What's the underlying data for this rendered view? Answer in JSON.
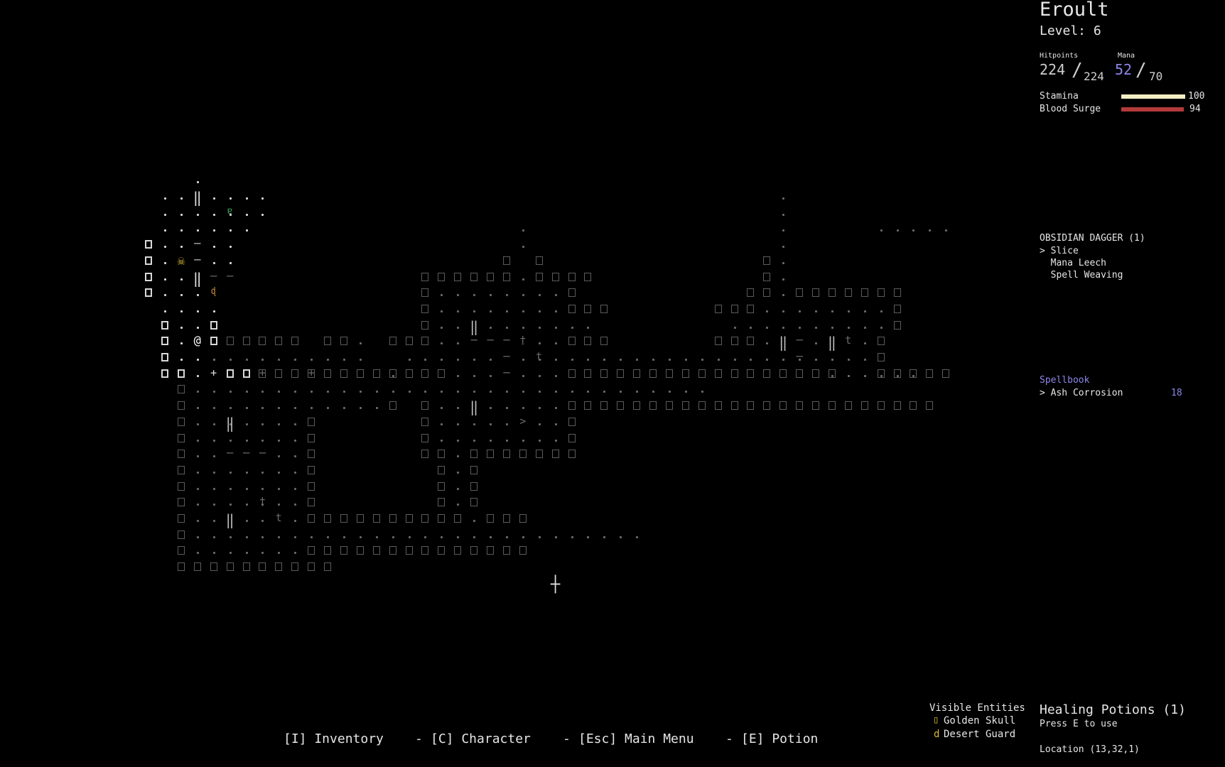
{
  "player": {
    "name": "Eroult",
    "level_label": "Level: 6"
  },
  "stats": {
    "hp_label": "Hitpoints",
    "hp_current": "224",
    "hp_max": "224",
    "mana_label": "Mana",
    "mana_current": "52",
    "mana_max": "70",
    "stamina_label": "Stamina",
    "stamina_value": "100",
    "stamina_fill": 1.0,
    "blood_label": "Blood Surge",
    "blood_value": "94",
    "blood_fill": 0.98
  },
  "weapon": {
    "title": "OBSIDIAN DAGGER (1)",
    "abilities": [
      "> Slice",
      "  Mana Leech",
      "  Spell Weaving"
    ]
  },
  "spellbook": {
    "title": "Spellbook",
    "spells": [
      {
        "name": "> Ash Corrosion",
        "cost": "18"
      }
    ]
  },
  "entities": {
    "title": "Visible Entities",
    "items": [
      {
        "glyph": "▯",
        "name": "Golden Skull"
      },
      {
        "glyph": "d",
        "name": "Desert Guard"
      }
    ]
  },
  "potions": {
    "title": "Healing Potions (1)",
    "hint": "Press E to use"
  },
  "location": "Location (13,32,1)",
  "footer": {
    "inventory": "[I] Inventory",
    "sep1": "-",
    "character": "[C] Character",
    "sep2": "-",
    "main_menu": "[Esc] Main Menu",
    "sep3": "-",
    "potion": "[E] Potion"
  },
  "colors": {
    "mana": "#8d87e8",
    "stamina": "#f3edc4",
    "blood": "#b23a3a",
    "spellbook": "#8d87e8",
    "skull": "#d8b832",
    "guard": "#d8b832"
  },
  "map_glyphs": {
    "player": "@",
    "stairs": ">",
    "cursor": "┼",
    "door_v": "‖",
    "door_h": "─",
    "grave": "†",
    "tree": "t",
    "plus": "+",
    "skull": "☠",
    "guard": "ɐ",
    "mob": "ɖ"
  }
}
